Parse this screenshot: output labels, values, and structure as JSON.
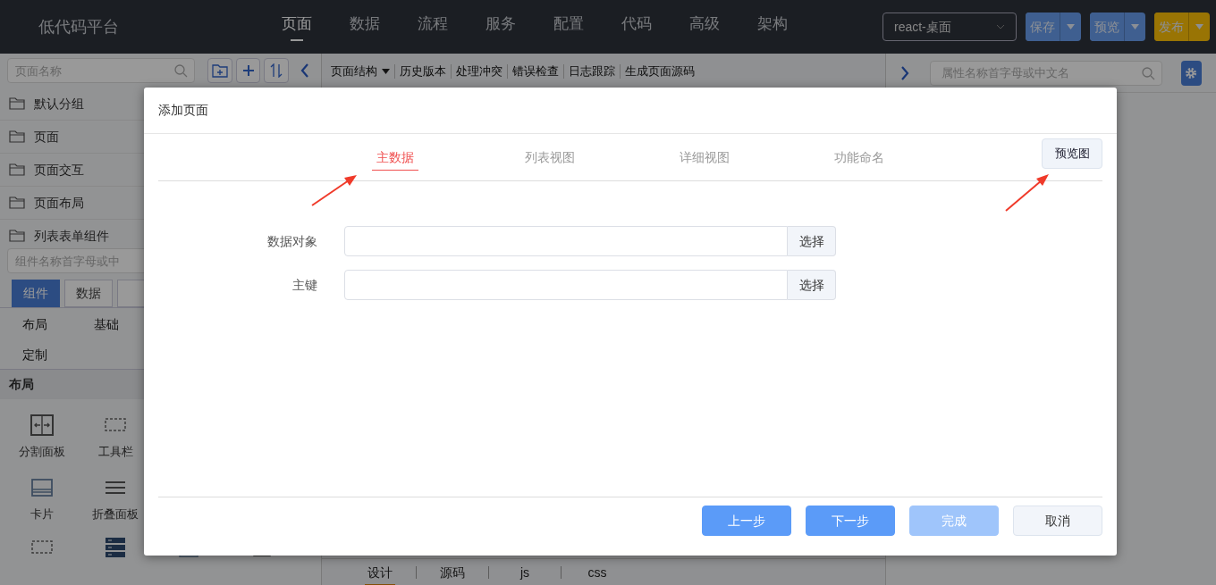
{
  "app": {
    "title": "低代码平台"
  },
  "nav": [
    {
      "label": "页面",
      "selected": true
    },
    {
      "label": "数据",
      "selected": false
    },
    {
      "label": "流程",
      "selected": false
    },
    {
      "label": "服务",
      "selected": false
    },
    {
      "label": "配置",
      "selected": false
    },
    {
      "label": "代码",
      "selected": false
    },
    {
      "label": "高级",
      "selected": false
    },
    {
      "label": "架构",
      "selected": false
    }
  ],
  "platform_select": {
    "value": "react-桌面"
  },
  "actions": [
    {
      "label": "保存",
      "kind": "primary"
    },
    {
      "label": "预览",
      "kind": "primary"
    },
    {
      "label": "发布",
      "kind": "warning"
    }
  ],
  "left_panel": {
    "search": {
      "placeholder": "页面名称"
    },
    "tree": [
      {
        "label": "默认分组"
      },
      {
        "label": "页面"
      },
      {
        "label": "页面交互"
      },
      {
        "label": "页面布局"
      },
      {
        "label": "列表表单组件"
      }
    ],
    "component_search": {
      "placeholder": "组件名称首字母或中"
    },
    "tabs": [
      {
        "label": "组件",
        "selected": true
      },
      {
        "label": "数据",
        "selected": false
      }
    ],
    "categories": [
      "布局",
      "基础",
      "定制"
    ],
    "section": "布局",
    "components": [
      "分割面板",
      "工具栏",
      "卡片",
      "折叠面板"
    ]
  },
  "center": {
    "toolbar": [
      "页面结构",
      "历史版本",
      "处理冲突",
      "错误检查",
      "日志跟踪",
      "生成页面源码"
    ],
    "bottom_tabs": [
      {
        "label": "设计",
        "selected": true
      },
      {
        "label": "源码",
        "selected": false
      },
      {
        "label": "js",
        "selected": false
      },
      {
        "label": "css",
        "selected": false
      }
    ]
  },
  "right_panel": {
    "search": {
      "placeholder": "属性名称首字母或中文名"
    }
  },
  "dialog": {
    "title": "添加页面",
    "steps": [
      {
        "label": "主数据",
        "selected": true
      },
      {
        "label": "列表视图",
        "selected": false
      },
      {
        "label": "详细视图",
        "selected": false
      },
      {
        "label": "功能命名",
        "selected": false
      }
    ],
    "preview_button": "预览图",
    "fields": [
      {
        "label": "数据对象",
        "button": "选择"
      },
      {
        "label": "主键",
        "button": "选择"
      }
    ],
    "buttons": [
      {
        "label": "上一步",
        "kind": "primary"
      },
      {
        "label": "下一步",
        "kind": "primary"
      },
      {
        "label": "完成",
        "kind": "disabled"
      },
      {
        "label": "取消",
        "kind": "default"
      }
    ]
  }
}
